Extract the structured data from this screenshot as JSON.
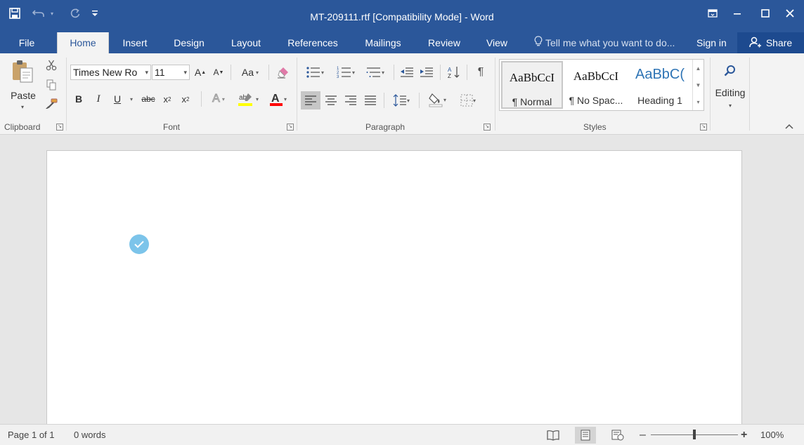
{
  "window": {
    "title": "MT-209111.rtf [Compatibility Mode] - Word",
    "save_icon": "save-icon",
    "undo_icon": "undo-icon",
    "redo_icon": "redo-icon",
    "customize_icon": "customize-quick-access-icon"
  },
  "tabs": [
    "File",
    "Home",
    "Insert",
    "Design",
    "Layout",
    "References",
    "Mailings",
    "Review",
    "View"
  ],
  "tell_me": "Tell me what you want to do...",
  "sign_in": "Sign in",
  "share": "Share",
  "ribbon": {
    "clipboard": {
      "paste": "Paste",
      "label": "Clipboard"
    },
    "font": {
      "name": "Times New Ro",
      "size": "11",
      "change_case": "Aa",
      "bold": "B",
      "italic": "I",
      "underline": "U",
      "strike": "abc",
      "sub": "x",
      "sup": "x",
      "label": "Font"
    },
    "paragraph": {
      "label": "Paragraph"
    },
    "styles": {
      "label": "Styles",
      "items": [
        {
          "preview": "AaBbCcI",
          "name": "¶ Normal"
        },
        {
          "preview": "AaBbCcI",
          "name": "¶ No Spac..."
        },
        {
          "preview": "AaBbC(",
          "name": "Heading 1"
        }
      ]
    },
    "editing": {
      "label": "Editing"
    }
  },
  "status": {
    "page": "Page 1 of 1",
    "words": "0 words",
    "zoom": "100%",
    "zoom_level": 0.5
  },
  "colors": {
    "accent": "#2b579a",
    "highlight": "#ffff00",
    "font_color": "#ff0000",
    "check": "#7cc4ea"
  }
}
